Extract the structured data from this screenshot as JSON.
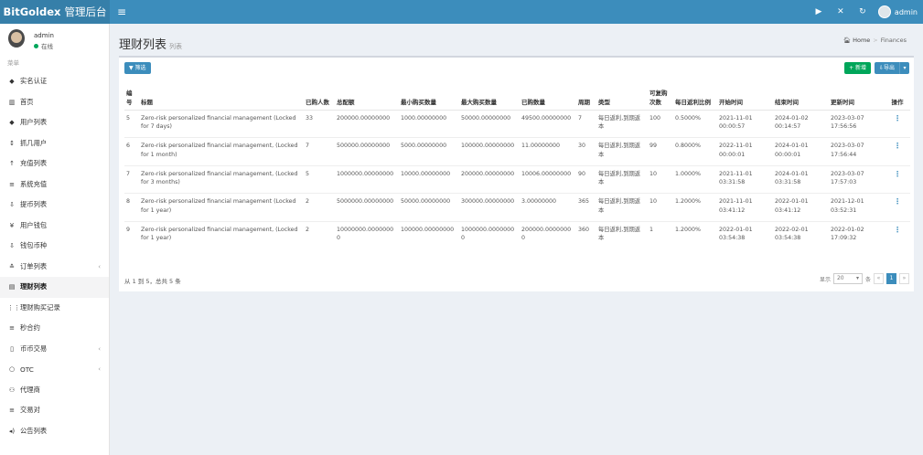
{
  "app": {
    "brand": "BitGoldex",
    "brand_sub": "管理后台"
  },
  "topbar": {
    "username": "admin",
    "icons": [
      "play-icon",
      "fullscreen-icon",
      "refresh-icon",
      "avatar"
    ]
  },
  "user": {
    "name": "admin",
    "status": "在线"
  },
  "menu": {
    "header": "菜单",
    "items": [
      {
        "label": "实名认证",
        "icon": "◆"
      },
      {
        "label": "首页",
        "icon": "▥"
      },
      {
        "label": "用户列表",
        "icon": "◆"
      },
      {
        "label": "抓几用户",
        "icon": "↕"
      },
      {
        "label": "充值列表",
        "icon": "↑"
      },
      {
        "label": "系统充值",
        "icon": "≡"
      },
      {
        "label": "提币列表",
        "icon": "⇩"
      },
      {
        "label": "用户钱包",
        "icon": "¥"
      },
      {
        "label": "钱包币种",
        "icon": "⇩"
      },
      {
        "label": "订单列表",
        "icon": "≛",
        "caret": "‹"
      },
      {
        "label": "理财列表",
        "icon": "▤",
        "active": true
      },
      {
        "label": "理财购买记录",
        "icon": "⋮⋮"
      },
      {
        "label": "秒合约",
        "icon": "≡"
      },
      {
        "label": "币币交易",
        "icon": "▯",
        "caret": "‹"
      },
      {
        "label": "OTC",
        "icon": "○",
        "caret": "‹"
      },
      {
        "label": "代理商",
        "icon": "⚇"
      },
      {
        "label": "交易对",
        "icon": "≡"
      },
      {
        "label": "公告列表",
        "icon": "◂)"
      }
    ]
  },
  "page": {
    "title": "理财列表",
    "subtitle": "列表"
  },
  "breadcrumb": {
    "home": "Home",
    "current": "Finances"
  },
  "toolbar": {
    "filter": "筛选",
    "add": "+ 新增",
    "export": "导出"
  },
  "table": {
    "headers": [
      "编号",
      "标题",
      "已购人数",
      "总配额",
      "最小购买数量",
      "最大购买数量",
      "已购数量",
      "周期",
      "类型",
      "可复购次数",
      "每日返利比例",
      "开始时间",
      "结束时间",
      "更新时间",
      "操作"
    ],
    "rows": [
      [
        "5",
        "Zero-risk personalized financial management (Locked for 7 days)",
        "33",
        "200000.00000000",
        "1000.00000000",
        "50000.00000000",
        "49500.00000000",
        "7",
        "每日返利,到期返本",
        "100",
        "0.5000%",
        "2021-11-01 00:00:57",
        "2024-01-02 00:14:57",
        "2023-03-07 17:56:56",
        "⋮"
      ],
      [
        "6",
        "Zero-risk personalized financial management, (Locked for 1 month)",
        "7",
        "500000.00000000",
        "5000.00000000",
        "100000.00000000",
        "11.00000000",
        "30",
        "每日返利,到期返本",
        "99",
        "0.8000%",
        "2022-11-01 00:00:01",
        "2024-01-01 00:00:01",
        "2023-03-07 17:56:44",
        "⋮"
      ],
      [
        "7",
        "Zero-risk personalized financial management, (Locked for 3 months)",
        "5",
        "1000000.00000000",
        "10000.00000000",
        "200000.00000000",
        "10006.00000000",
        "90",
        "每日返利,到期返本",
        "10",
        "1.0000%",
        "2021-11-01 03:31:58",
        "2024-01-01 03:31:58",
        "2023-03-07 17:57:03",
        "⋮"
      ],
      [
        "8",
        "Zero-risk personalized financial management (Locked for 1 year)",
        "2",
        "5000000.00000000",
        "50000.00000000",
        "300000.00000000",
        "3.00000000",
        "365",
        "每日返利,到期返本",
        "10",
        "1.2000%",
        "2021-11-01 03:41:12",
        "2022-01-01 03:41:12",
        "2021-12-01 03:52:31",
        "⋮"
      ],
      [
        "9",
        "Zero-risk personalized financial management, (Locked for 1 year)",
        "2",
        "10000000.00000000",
        "100000.00000000",
        "1000000.00000000",
        "200000.00000000",
        "360",
        "每日返利,到期返本",
        "1",
        "1.2000%",
        "2022-01-01 03:54:38",
        "2022-02-01 03:54:38",
        "2022-01-02 17:09:32",
        "⋮"
      ]
    ]
  },
  "pagination": {
    "info": "从 1 到 5，总共 5 条",
    "show_label": "显示",
    "page_size": "20",
    "per_label": "条",
    "prev": "«",
    "current": "1",
    "next": "»"
  },
  "colors": {
    "primary": "#3c8dbc",
    "logo_bg": "#367fa9",
    "success": "#00a65a",
    "bg": "#ecf0f5"
  }
}
